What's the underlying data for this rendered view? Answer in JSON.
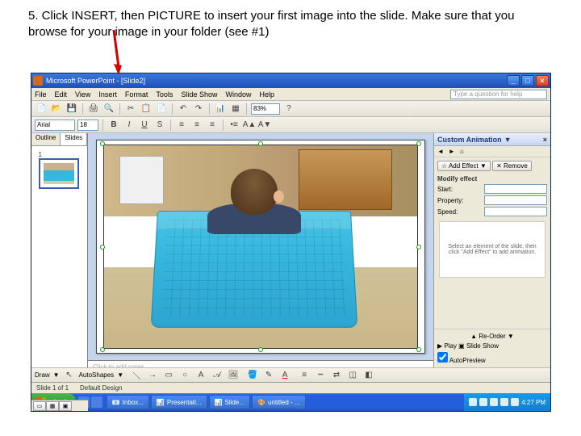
{
  "instruction": "5. Click INSERT, then PICTURE to insert your first image into the slide. Make sure that you browse for your image in your folder (see #1)",
  "titlebar": {
    "title": "Microsoft PowerPoint - [Slide2]",
    "min": "_",
    "max": "□",
    "close": "×"
  },
  "menu": {
    "file": "File",
    "edit": "Edit",
    "view": "View",
    "insert": "Insert",
    "format": "Format",
    "tools": "Tools",
    "slideshow": "Slide Show",
    "window": "Window",
    "help": "Help"
  },
  "typeq": "Type a question for help",
  "toolbar1": {
    "zoom": "83%",
    "font": "Arial",
    "size": "18"
  },
  "outline": {
    "tab1": "Outline",
    "tab2": "Slides",
    "num": "1"
  },
  "notes": "Click to add notes",
  "draw": {
    "label": "Draw",
    "autoshapes": "AutoShapes"
  },
  "task": {
    "title": "Custom Animation",
    "back": "◄",
    "fwd": "►",
    "add": "Add Effect",
    "remove": "Remove",
    "section": "Modify effect",
    "start": "Start:",
    "property": "Property:",
    "speed": "Speed:",
    "hint": "Select an element of the slide, then click \"Add Effect\" to add animation.",
    "reorder": "Re-Order",
    "play": "Play",
    "slideshow": "Slide Show",
    "autoprev": "AutoPreview"
  },
  "status": {
    "slide": "Slide 1 of 1",
    "design": "Default Design"
  },
  "taskbar": {
    "start": "start",
    "items": [
      "Inbox...",
      "Presentati...",
      "Slide...",
      "untitled - ..."
    ],
    "time": "4:27 PM"
  }
}
